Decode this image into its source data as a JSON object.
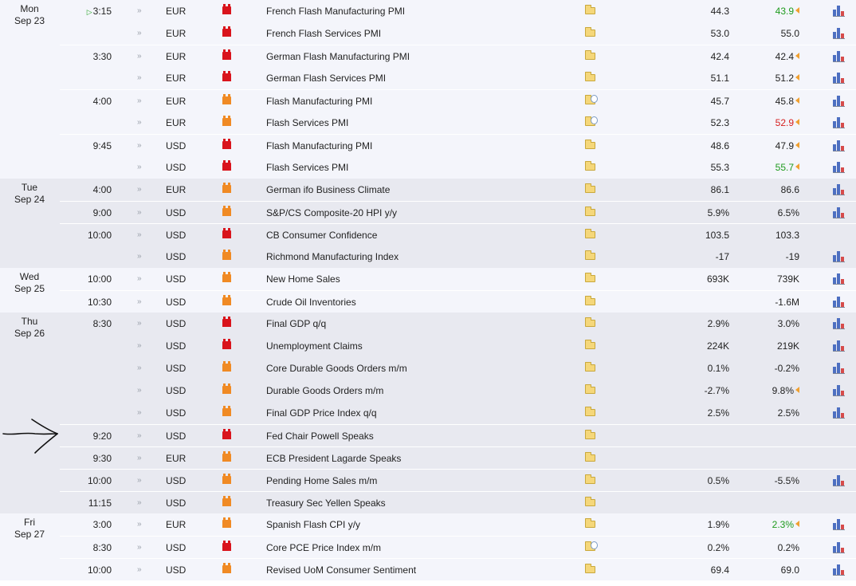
{
  "days": [
    {
      "weekday": "Mon",
      "date": "Sep 23",
      "events": [
        {
          "time": "3:15",
          "live": true,
          "currency": "EUR",
          "importance": "high",
          "name": "French Flash Manufacturing PMI",
          "detail_icon": "folder-icon",
          "actual": "44.3",
          "previous": "43.9",
          "previous_color": "green",
          "revised": true,
          "chart": true
        },
        {
          "time": "",
          "currency": "EUR",
          "importance": "high",
          "name": "French Flash Services PMI",
          "detail_icon": "folder-icon",
          "actual": "53.0",
          "previous": "55.0",
          "previous_color": "",
          "revised": false,
          "chart": true
        },
        {
          "time": "3:30",
          "currency": "EUR",
          "importance": "high",
          "name": "German Flash Manufacturing PMI",
          "detail_icon": "folder-icon",
          "actual": "42.4",
          "previous": "42.4",
          "previous_color": "",
          "revised": true,
          "chart": true
        },
        {
          "time": "",
          "currency": "EUR",
          "importance": "high",
          "name": "German Flash Services PMI",
          "detail_icon": "folder-icon",
          "actual": "51.1",
          "previous": "51.2",
          "previous_color": "",
          "revised": true,
          "chart": true
        },
        {
          "time": "4:00",
          "currency": "EUR",
          "importance": "medium",
          "name": "Flash Manufacturing PMI",
          "detail_icon": "folder-document-icon",
          "actual": "45.7",
          "previous": "45.8",
          "previous_color": "",
          "revised": true,
          "chart": true
        },
        {
          "time": "",
          "currency": "EUR",
          "importance": "medium",
          "name": "Flash Services PMI",
          "detail_icon": "folder-document-icon",
          "actual": "52.3",
          "previous": "52.9",
          "previous_color": "red",
          "revised": true,
          "chart": true
        },
        {
          "time": "9:45",
          "currency": "USD",
          "importance": "high",
          "name": "Flash Manufacturing PMI",
          "detail_icon": "folder-icon",
          "actual": "48.6",
          "previous": "47.9",
          "previous_color": "",
          "revised": true,
          "chart": true
        },
        {
          "time": "",
          "currency": "USD",
          "importance": "high",
          "name": "Flash Services PMI",
          "detail_icon": "folder-icon",
          "actual": "55.3",
          "previous": "55.7",
          "previous_color": "green",
          "revised": true,
          "chart": true
        }
      ]
    },
    {
      "weekday": "Tue",
      "date": "Sep 24",
      "events": [
        {
          "time": "4:00",
          "currency": "EUR",
          "importance": "medium",
          "name": "German ifo Business Climate",
          "detail_icon": "folder-icon",
          "actual": "86.1",
          "previous": "86.6",
          "previous_color": "",
          "revised": false,
          "chart": true
        },
        {
          "time": "9:00",
          "currency": "USD",
          "importance": "medium",
          "name": "S&P/CS Composite-20 HPI y/y",
          "detail_icon": "folder-icon",
          "actual": "5.9%",
          "previous": "6.5%",
          "previous_color": "",
          "revised": false,
          "chart": true
        },
        {
          "time": "10:00",
          "currency": "USD",
          "importance": "high",
          "name": "CB Consumer Confidence",
          "detail_icon": "folder-icon",
          "actual": "103.5",
          "previous": "103.3",
          "previous_color": "",
          "revised": false,
          "chart": false
        },
        {
          "time": "",
          "currency": "USD",
          "importance": "medium",
          "name": "Richmond Manufacturing Index",
          "detail_icon": "folder-icon",
          "actual": "-17",
          "previous": "-19",
          "previous_color": "",
          "revised": false,
          "chart": true
        }
      ]
    },
    {
      "weekday": "Wed",
      "date": "Sep 25",
      "events": [
        {
          "time": "10:00",
          "currency": "USD",
          "importance": "medium",
          "name": "New Home Sales",
          "detail_icon": "folder-icon",
          "actual": "693K",
          "previous": "739K",
          "previous_color": "",
          "revised": false,
          "chart": true
        },
        {
          "time": "10:30",
          "currency": "USD",
          "importance": "medium",
          "name": "Crude Oil Inventories",
          "detail_icon": "folder-icon",
          "actual": "",
          "previous": "-1.6M",
          "previous_color": "",
          "revised": false,
          "chart": true
        }
      ]
    },
    {
      "weekday": "Thu",
      "date": "Sep 26",
      "events": [
        {
          "time": "8:30",
          "currency": "USD",
          "importance": "high",
          "name": "Final GDP q/q",
          "detail_icon": "folder-icon",
          "actual": "2.9%",
          "previous": "3.0%",
          "previous_color": "",
          "revised": false,
          "chart": true
        },
        {
          "time": "",
          "currency": "USD",
          "importance": "high",
          "name": "Unemployment Claims",
          "detail_icon": "folder-icon",
          "actual": "224K",
          "previous": "219K",
          "previous_color": "",
          "revised": false,
          "chart": true
        },
        {
          "time": "",
          "currency": "USD",
          "importance": "medium",
          "name": "Core Durable Goods Orders m/m",
          "detail_icon": "folder-icon",
          "actual": "0.1%",
          "previous": "-0.2%",
          "previous_color": "",
          "revised": false,
          "chart": true
        },
        {
          "time": "",
          "currency": "USD",
          "importance": "medium",
          "name": "Durable Goods Orders m/m",
          "detail_icon": "folder-icon",
          "actual": "-2.7%",
          "previous": "9.8%",
          "previous_color": "",
          "revised": true,
          "chart": true
        },
        {
          "time": "",
          "currency": "USD",
          "importance": "medium",
          "name": "Final GDP Price Index q/q",
          "detail_icon": "folder-icon",
          "actual": "2.5%",
          "previous": "2.5%",
          "previous_color": "",
          "revised": false,
          "chart": true
        },
        {
          "time": "9:20",
          "currency": "USD",
          "importance": "high",
          "name": "Fed Chair Powell Speaks",
          "detail_icon": "folder-icon",
          "actual": "",
          "previous": "",
          "previous_color": "",
          "revised": false,
          "chart": false
        },
        {
          "time": "9:30",
          "currency": "EUR",
          "importance": "medium",
          "name": "ECB President Lagarde Speaks",
          "detail_icon": "folder-icon",
          "actual": "",
          "previous": "",
          "previous_color": "",
          "revised": false,
          "chart": false
        },
        {
          "time": "10:00",
          "currency": "USD",
          "importance": "medium",
          "name": "Pending Home Sales m/m",
          "detail_icon": "folder-icon",
          "actual": "0.5%",
          "previous": "-5.5%",
          "previous_color": "",
          "revised": false,
          "chart": true
        },
        {
          "time": "11:15",
          "currency": "USD",
          "importance": "medium",
          "name": "Treasury Sec Yellen Speaks",
          "detail_icon": "folder-icon",
          "actual": "",
          "previous": "",
          "previous_color": "",
          "revised": false,
          "chart": false
        }
      ]
    },
    {
      "weekday": "Fri",
      "date": "Sep 27",
      "events": [
        {
          "time": "3:00",
          "currency": "EUR",
          "importance": "medium",
          "name": "Spanish Flash CPI y/y",
          "detail_icon": "folder-icon",
          "actual": "1.9%",
          "previous": "2.3%",
          "previous_color": "green",
          "revised": true,
          "chart": true
        },
        {
          "time": "8:30",
          "currency": "USD",
          "importance": "high",
          "name": "Core PCE Price Index m/m",
          "detail_icon": "folder-document-icon",
          "actual": "0.2%",
          "previous": "0.2%",
          "previous_color": "",
          "revised": false,
          "chart": true
        },
        {
          "time": "10:00",
          "currency": "USD",
          "importance": "medium",
          "name": "Revised UoM Consumer Sentiment",
          "detail_icon": "folder-icon",
          "actual": "69.4",
          "previous": "69.0",
          "previous_color": "",
          "revised": false,
          "chart": true
        }
      ]
    }
  ],
  "icons": {
    "sound": "speaker-icon",
    "importance_high": "red-impact-icon",
    "importance_medium": "orange-impact-icon",
    "chart": "bar-chart-icon",
    "revised": "revised-marker-icon",
    "live": "play-icon"
  },
  "colors": {
    "high": "#d9141c",
    "medium": "#f08a24",
    "better": "#1f9b1f",
    "worse": "#d62020"
  },
  "annotation": "hand-drawn-arrow-icon"
}
